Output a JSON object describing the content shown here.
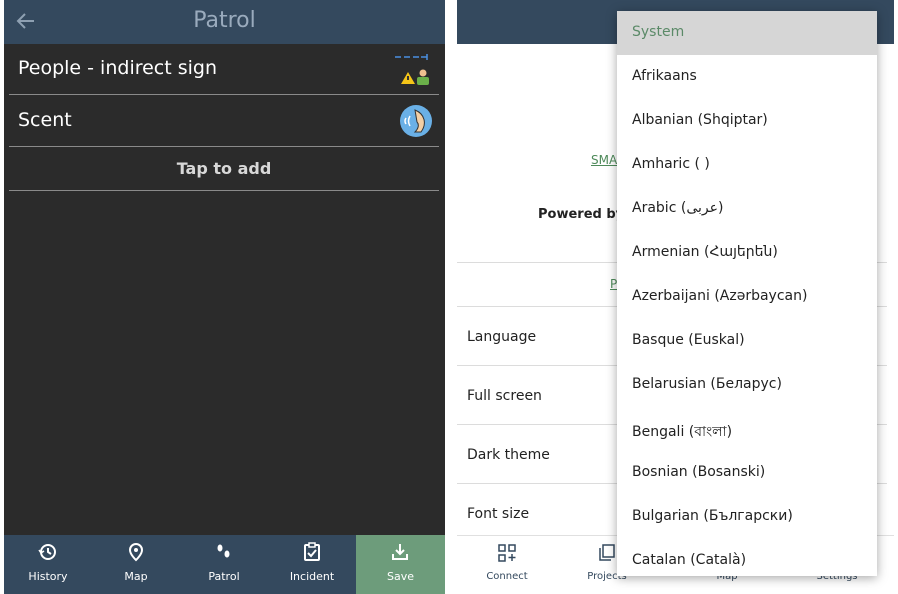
{
  "left": {
    "title": "Patrol",
    "rows": [
      {
        "label": "People - indirect sign",
        "icon": "people-warning-icon"
      },
      {
        "label": "Scent",
        "icon": "scent-nose-icon"
      }
    ],
    "tap_to_add": "Tap to add",
    "nav": [
      {
        "label": "History",
        "icon": "history-icon"
      },
      {
        "label": "Map",
        "icon": "map-pin-icon"
      },
      {
        "label": "Patrol",
        "icon": "footprints-icon"
      },
      {
        "label": "Incident",
        "icon": "clipboard-check-icon"
      },
      {
        "label": "Save",
        "icon": "download-icon"
      }
    ]
  },
  "right": {
    "behind": {
      "link_fragment": "SMA",
      "powered_by": "Powered by",
      "link_letter": "P"
    },
    "settings": [
      {
        "label": "Language"
      },
      {
        "label": "Full screen"
      },
      {
        "label": "Dark theme"
      },
      {
        "label": "Font size"
      }
    ],
    "nav": [
      {
        "label": "Connect",
        "icon": "qr-add-icon"
      },
      {
        "label": "Projects",
        "icon": "projects-icon"
      },
      {
        "label": "Map",
        "icon": "map-icon"
      },
      {
        "label": "Settings",
        "icon": "settings-icon"
      }
    ],
    "language_options": [
      {
        "label": "System",
        "selected": true
      },
      {
        "label": "Afrikaans"
      },
      {
        "label": "Albanian (Shqiptar)"
      },
      {
        "label": "Amharic (      )"
      },
      {
        "label": "Arabic (عربى)"
      },
      {
        "label": "Armenian (Հայերեն)"
      },
      {
        "label": "Azerbaijani (Azərbaycan)"
      },
      {
        "label": "Basque (Euskal)"
      },
      {
        "label": "Belarusian (Беларус)"
      },
      {
        "label": "Bengali (বাংলা)"
      },
      {
        "label": "Bosnian (Bosanski)"
      },
      {
        "label": "Bulgarian (Български)"
      },
      {
        "label": "Catalan (Català)"
      }
    ]
  },
  "colors": {
    "header": "#34495e",
    "dark_bg": "#2b2b2b",
    "save_green": "#6d9c7b",
    "selected_option_bg": "#d6d6d6"
  }
}
